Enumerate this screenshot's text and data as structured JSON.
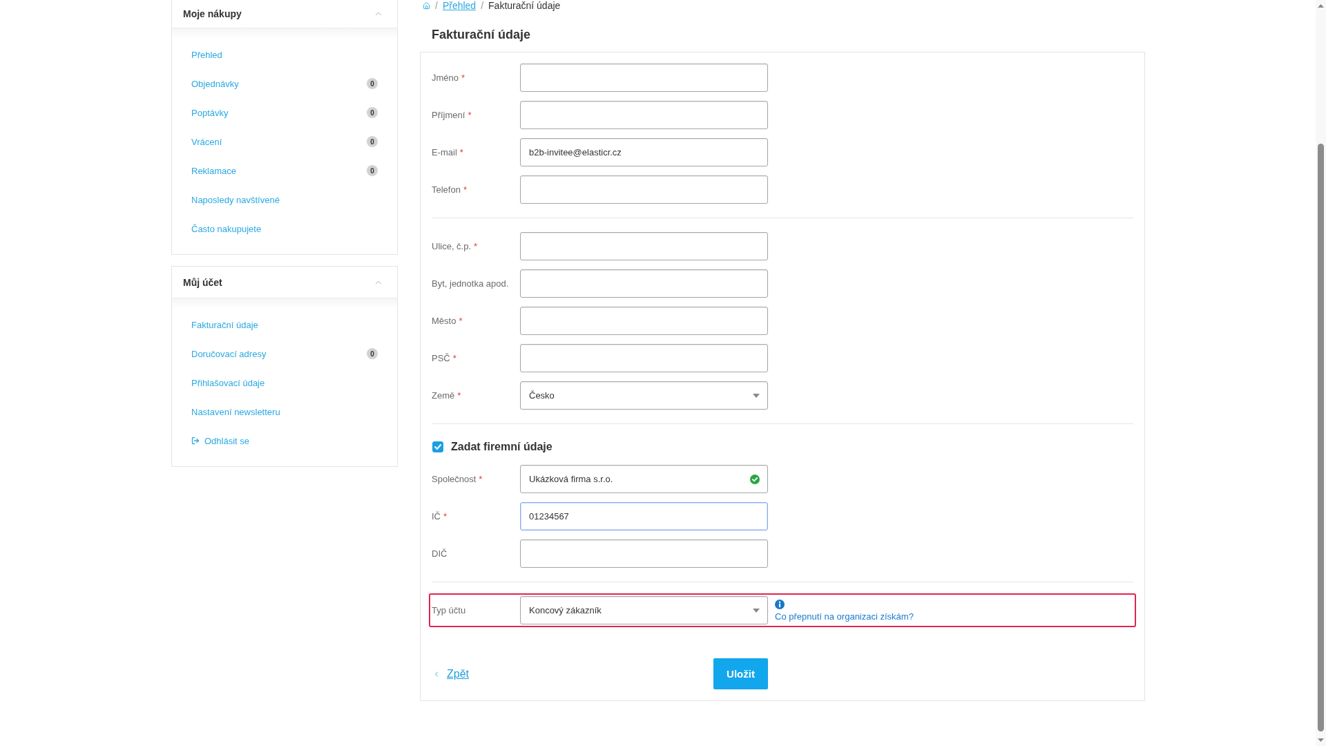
{
  "breadcrumb": [
    {
      "separator": "/",
      "label": "Přehled",
      "link": true
    },
    {
      "separator": "/",
      "label": "Fakturační údaje",
      "link": false
    }
  ],
  "sidebar": [
    {
      "title": "Moje nákupy",
      "expanded": true,
      "items": [
        {
          "kind": "link",
          "label": "Přehled"
        },
        {
          "kind": "link",
          "label": "Objednávky",
          "count": "0"
        },
        {
          "kind": "link",
          "label": "Poptávky",
          "count": "0"
        },
        {
          "kind": "link",
          "label": "Vrácení",
          "count": "0"
        },
        {
          "kind": "link",
          "label": "Reklamace",
          "count": "0"
        },
        {
          "kind": "link",
          "label": "Naposledy navštívené"
        },
        {
          "kind": "link",
          "label": "Často nakupujete"
        }
      ]
    },
    {
      "title": "Můj účet",
      "expanded": true,
      "items": [
        {
          "kind": "link",
          "label": "Fakturační údaje"
        },
        {
          "kind": "link",
          "label": "Doručovací adresy",
          "count": "0"
        },
        {
          "kind": "link",
          "label": "Přihlašovací údaje"
        },
        {
          "kind": "link",
          "label": "Nastavení newsletteru"
        },
        {
          "kind": "logout",
          "label": "Odhlásit se"
        }
      ]
    }
  ],
  "page_title": "Fakturační údaje",
  "form": {
    "sections": [
      {
        "highlighted": false,
        "fields": [
          {
            "kind": "text",
            "label": "Jméno",
            "required_mark": "*",
            "focused": false,
            "valid": false
          },
          {
            "kind": "text",
            "label": "Příjmení",
            "required_mark": "*",
            "focused": false,
            "valid": false
          },
          {
            "kind": "text",
            "label": "E-mail",
            "required_mark": "*",
            "value": "b2b-invitee@elasticr.cz",
            "focused": false,
            "valid": false
          },
          {
            "kind": "text",
            "label": "Telefon",
            "required_mark": "*",
            "focused": false,
            "valid": false
          }
        ]
      },
      {
        "highlighted": false,
        "fields": [
          {
            "kind": "text",
            "label": "Ulice, č.p.",
            "required_mark": "*",
            "focused": false,
            "valid": false
          },
          {
            "kind": "text",
            "label": "Byt, jednotka apod.",
            "focused": false,
            "valid": false
          },
          {
            "kind": "text",
            "label": "Město",
            "required_mark": "*",
            "focused": false,
            "valid": false
          },
          {
            "kind": "text",
            "label": "PSČ",
            "required_mark": "*",
            "focused": false,
            "valid": false
          },
          {
            "kind": "select",
            "label": "Země",
            "required_mark": "*",
            "value": "Česko",
            "focused": false,
            "valid": false
          }
        ]
      },
      {
        "highlighted": false,
        "checkbox": {
          "label": "Zadat firemní údaje",
          "checked": true
        },
        "fields": [
          {
            "kind": "text",
            "label": "Společnost",
            "required_mark": "*",
            "value": "Ukázková firma s.r.o.",
            "focused": false,
            "valid": true
          },
          {
            "kind": "text",
            "label": "IČ",
            "required_mark": "*",
            "value": "01234567",
            "focused": true,
            "valid": false
          },
          {
            "kind": "text",
            "label": "DIČ",
            "focused": false,
            "valid": false
          }
        ]
      },
      {
        "highlighted": true,
        "fields": [
          {
            "kind": "select",
            "label": "Typ účtu",
            "value": "Koncový zákazník",
            "focused": false,
            "valid": false,
            "help_link": "Co přepnutí na organizaci získám?"
          }
        ]
      }
    ],
    "back_link": "Zpět",
    "submit": "Uložit"
  }
}
